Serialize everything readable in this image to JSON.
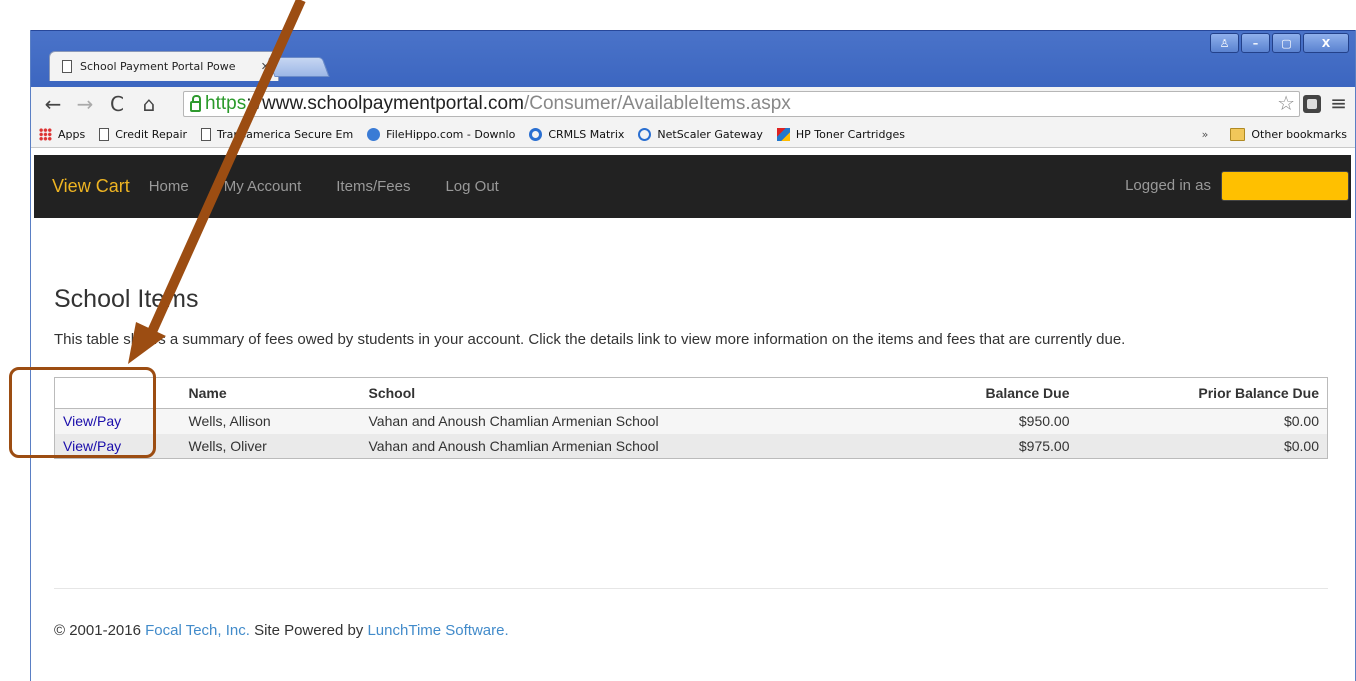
{
  "browser": {
    "tab_title": "School Payment Portal Powe",
    "tab_close": "✕",
    "url_scheme": "https",
    "url_rest": "://www.schoolpaymentportal.com",
    "url_path": "/Consumer/AvailableItems.aspx",
    "window_controls": [
      "♙",
      "–",
      "▢",
      "X"
    ],
    "bookmarks": [
      {
        "label": "Apps",
        "icon": "apps-icon"
      },
      {
        "label": "Credit Repair",
        "icon": "page-icon"
      },
      {
        "label": "Transamerica Secure Em",
        "icon": "page-icon"
      },
      {
        "label": "FileHippo.com - Downlo",
        "icon": "filehippo-icon"
      },
      {
        "label": "CRMLS Matrix",
        "icon": "crmls-icon"
      },
      {
        "label": "NetScaler Gateway",
        "icon": "netscaler-icon"
      },
      {
        "label": "HP Toner Cartridges",
        "icon": "hp-icon"
      }
    ],
    "bookmarks_overflow": "»",
    "other_bookmarks": "Other bookmarks"
  },
  "nav": {
    "brand": "View Cart",
    "links": [
      "Home",
      "My Account",
      "Items/Fees",
      "Log Out"
    ],
    "logged_in": "Logged in as"
  },
  "page": {
    "title": "School Items",
    "intro": "This table shows a summary of fees owed by students in your account. Click the details link to view more information on the items and fees that are currently due."
  },
  "table": {
    "headers": [
      "",
      "Name",
      "School",
      "Balance Due",
      "Prior Balance Due"
    ],
    "rows": [
      {
        "action": "View/Pay",
        "name": "Wells, Allison",
        "school": "Vahan and Anoush Chamlian Armenian School",
        "balance": "$950.00",
        "prior": "$0.00"
      },
      {
        "action": "View/Pay",
        "name": "Wells, Oliver",
        "school": "Vahan and Anoush Chamlian Armenian School",
        "balance": "$975.00",
        "prior": "$0.00"
      }
    ]
  },
  "footer": {
    "copyright": "© 2001-2016 ",
    "company": "Focal Tech, Inc.",
    "powered": " Site Powered by ",
    "software": "LunchTime Software."
  },
  "colors": {
    "brand": "#eeb422",
    "navbar": "#222222",
    "annotation": "#9c4d12",
    "redaction": "#ffc000"
  }
}
